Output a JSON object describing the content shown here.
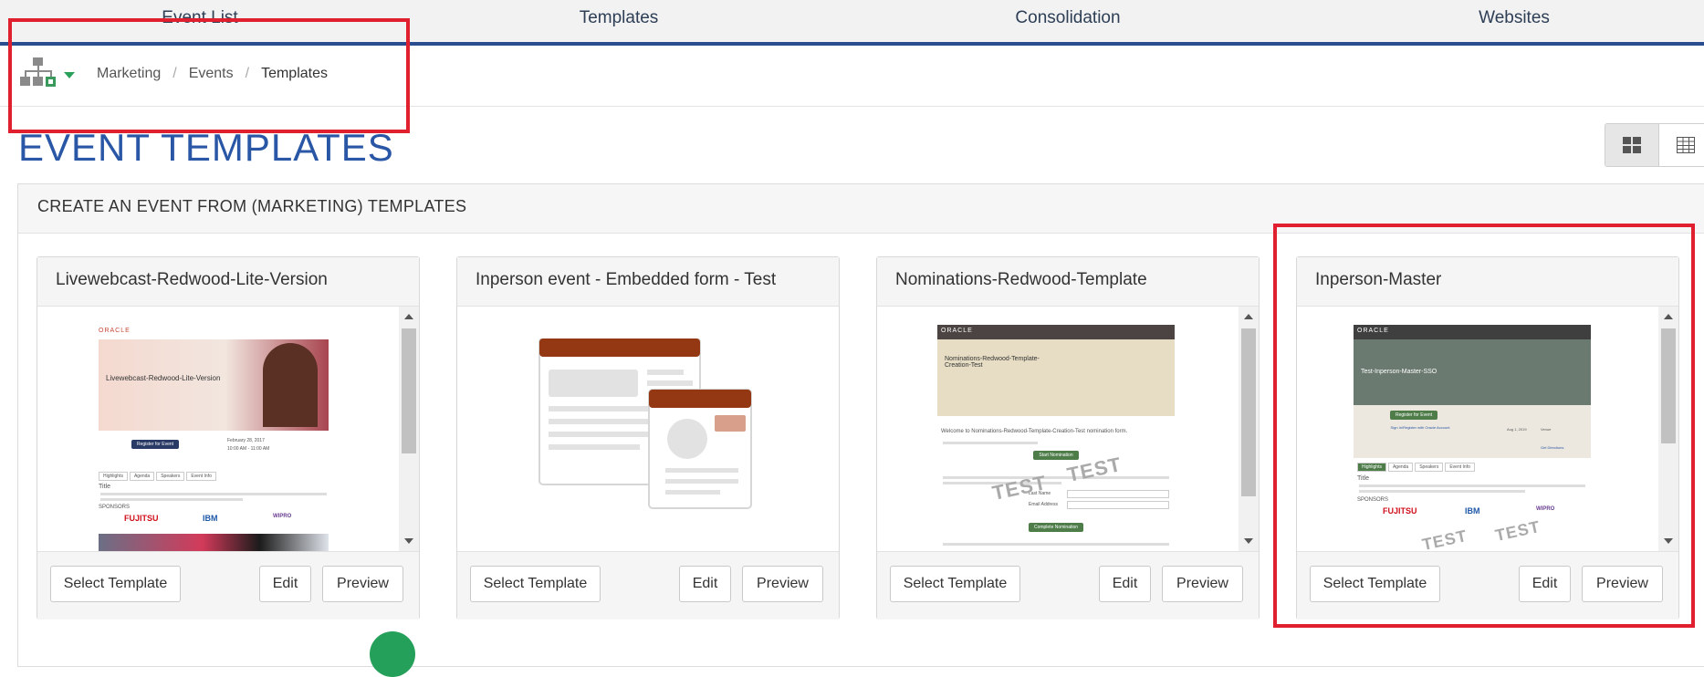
{
  "topnav": {
    "tabs": [
      "Event List",
      "Templates",
      "Consolidation",
      "Websites"
    ]
  },
  "breadcrumb": {
    "items": [
      "Marketing",
      "Events",
      "Templates"
    ],
    "separator": "/"
  },
  "page": {
    "title": "EVENT TEMPLATES"
  },
  "panel": {
    "heading": "CREATE AN EVENT FROM (MARKETING) TEMPLATES"
  },
  "buttons": {
    "select": "Select Template",
    "edit": "Edit",
    "preview": "Preview"
  },
  "cards": [
    {
      "title": "Livewebcast-Redwood-Lite-Version",
      "thumb": {
        "brand": "ORACLE",
        "hero_text": "Livewebcast-Redwood-Lite-Version",
        "register": "Register for Event",
        "date": "February 28, 2017",
        "time": "10:00 AM - 11:00 AM",
        "tabs": [
          "Highlights",
          "Agenda",
          "Speakers",
          "Event Info"
        ],
        "section_title": "Title",
        "sponsors_label": "SPONSORS",
        "sponsors": [
          "FUJITSU",
          "IBM",
          "WIPRO"
        ]
      }
    },
    {
      "title": "Inperson event - Embedded form - Test"
    },
    {
      "title": "Nominations-Redwood-Template",
      "thumb": {
        "brand": "ORACLE",
        "hero_text": "Nominations-Redwood-Template-Creation-Test",
        "welcome": "Welcome to Nominations-Redwood-Template-Creation-Test nomination form.",
        "start_button": "Start Nomination",
        "complete_button": "Complete Nomination",
        "field1": "Last Name",
        "field2": "Email Address",
        "stamp": "TEST"
      }
    },
    {
      "title": "Inperson-Master",
      "thumb": {
        "brand": "ORACLE",
        "hero_text": "Test-Inperson-Master-SSO",
        "register": "Register for Event",
        "signin": "Sign In/Register with Oracle Account",
        "date": "Aug 1, 2019",
        "venue": "Venue",
        "directions": "Get Directions",
        "tabs": [
          "Highlights",
          "Agenda",
          "Speakers",
          "Event Info"
        ],
        "section_title": "Title",
        "sponsors_label": "SPONSORS",
        "sponsors": [
          "FUJITSU",
          "IBM",
          "WIPRO"
        ],
        "stamp": "TEST"
      }
    }
  ],
  "colors": {
    "nav_underline": "#2a4d8f",
    "title": "#2a56a6",
    "highlight": "#e0202e",
    "oracle_red": "#c74634",
    "fab": "#24a05a"
  }
}
